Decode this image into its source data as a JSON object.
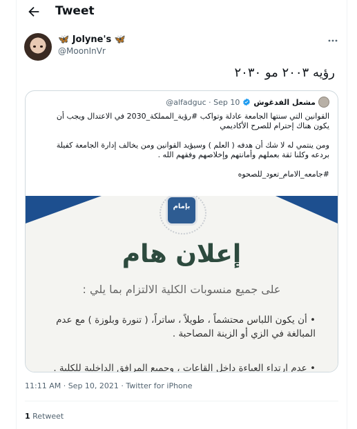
{
  "header": {
    "title": "Tweet",
    "back_icon": "back-arrow-icon"
  },
  "author": {
    "display_name": "🦋 Jolyne's 🦋",
    "handle": "@MoonInVr"
  },
  "tweet": {
    "text": "رؤيه ٢٠٠٣ مو ٢٠٣٠"
  },
  "quote": {
    "name": "مشعل الفدغوش",
    "handle": "@alfadguc",
    "date": "· Sep 10",
    "verified_color": "#1d9bf0",
    "lines": [
      "القوانين التي سنتها الجامعة عادلة وتواكب #رؤية_المملكة_2030 في الاعتدال ويجب أن",
      "يكون هناك إحترام للصرح الأكاديمي",
      "",
      "ومن ينتمي له لا شك أن هدفه ( العلم ) وسيؤيد القوانين ومن يخالف إدارة الجامعة كفيلة",
      "بردعه وكلنا ثقة بعملهم وأمانتهم وإخلاصهم وفقهم الله .",
      "",
      "#جامعه_الامام_تعود_للصحوه"
    ],
    "image": {
      "logo_text": "بإمام",
      "title": "إعلان هام",
      "subtitle": "على جميع منسوبات الكلية الالتزام بما يلي :",
      "bullet1": "• أن يكون اللباس محتشماً ، طويلاً ، ساتراً، ( تنورة وبلوزة ) مع عدم المبالغة في الزي أو الزينة المصاحبة .",
      "bullet2": "• عدم ارتداء العباءة داخل القاعات ، وجميع المرافق الداخلية للكلية .",
      "band_color": "#1d4f8f",
      "title_color": "#2d4a3e"
    }
  },
  "meta": {
    "timestamp": "11:11 AM · Sep 10, 2021 · Twitter for iPhone"
  },
  "stats": {
    "retweet_count": "1",
    "retweet_label": "Retweet"
  }
}
